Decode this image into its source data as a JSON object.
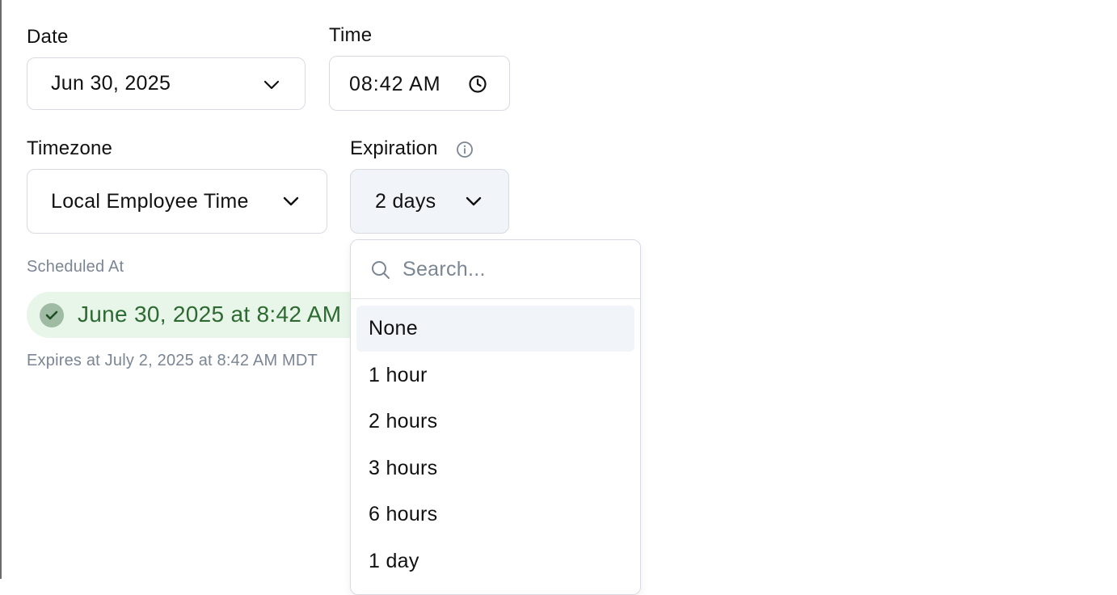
{
  "date": {
    "label": "Date",
    "value": "Jun 30, 2025"
  },
  "time": {
    "label": "Time",
    "value": "08:42 AM"
  },
  "timezone": {
    "label": "Timezone",
    "value": "Local Employee Time"
  },
  "expiration": {
    "label": "Expiration",
    "value": "2 days",
    "search_placeholder": "Search...",
    "options": [
      "None",
      "1 hour",
      "2 hours",
      "3 hours",
      "6 hours",
      "1 day"
    ],
    "highlighted_option": "None"
  },
  "scheduled": {
    "label": "Scheduled At",
    "value": "June 30, 2025 at 8:42 AM",
    "expires_text": "Expires at July 2, 2025 at 8:42 AM MDT"
  },
  "colors": {
    "success_bg": "#e7f6e9",
    "success_text": "#2d6a31",
    "muted_text": "#7b8594",
    "highlight_bg": "#f1f4f8"
  }
}
